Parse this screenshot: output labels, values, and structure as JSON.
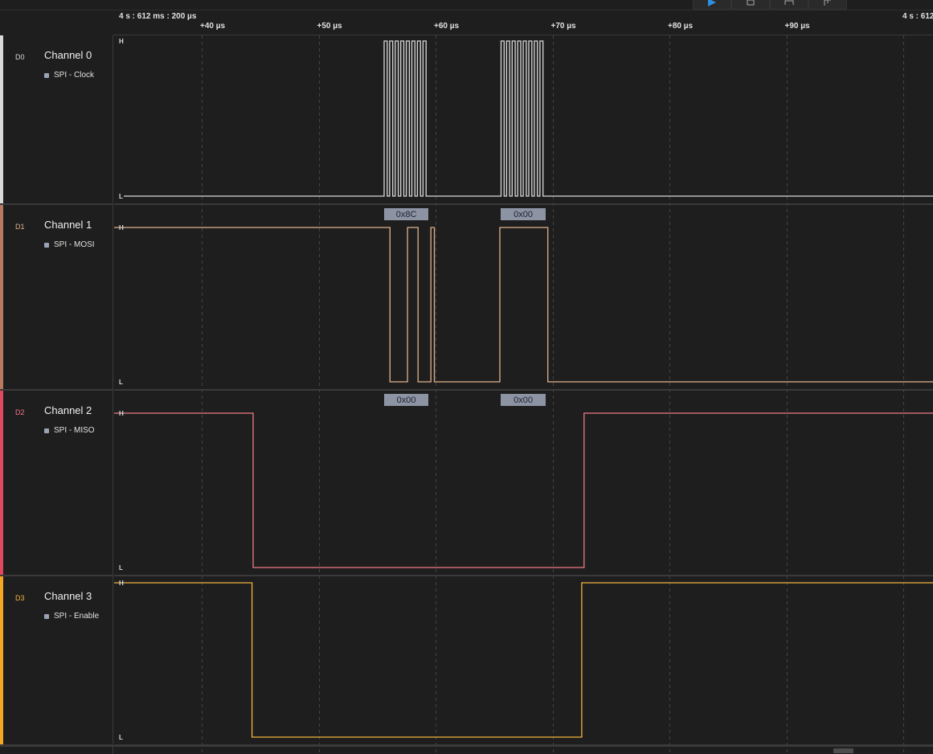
{
  "timebar": {
    "start_time": "4 s : 612 ms : 200 µs",
    "end_time_partial": "4 s : 612",
    "ticks": [
      "+40 µs",
      "+50 µs",
      "+60 µs",
      "+70 µs",
      "+80 µs",
      "+90 µs"
    ]
  },
  "toolbar": {
    "icons": [
      "play-icon",
      "trigger-icon",
      "ruler-icon",
      "marker-icon"
    ],
    "accent": "#2f8fe0"
  },
  "channels": [
    {
      "tag": "D0",
      "name": "Channel 0",
      "analyzer": "SPI - Clock",
      "color": "#d9d9d9",
      "high": "H",
      "low": "L",
      "signal": "clock",
      "bursts": [
        {
          "start_us": 55.6,
          "end_us": 59.4,
          "pulses": 8
        },
        {
          "start_us": 65.6,
          "end_us": 69.4,
          "pulses": 8
        }
      ]
    },
    {
      "tag": "D1",
      "name": "Channel 1",
      "analyzer": "SPI - MOSI",
      "color": "#e1b18a",
      "high": "H",
      "low": "L",
      "signal": "data",
      "initial": 1,
      "transitions_us": [
        56.1,
        57.6,
        58.5,
        59.6,
        59.9,
        65.5,
        69.6
      ],
      "decodes": [
        {
          "text": "0x8C",
          "start_us": 55.6,
          "end_us": 59.4
        },
        {
          "text": "0x00",
          "start_us": 65.6,
          "end_us": 69.4
        }
      ]
    },
    {
      "tag": "D2",
      "name": "Channel 2",
      "analyzer": "SPI - MISO",
      "color": "#f07a86",
      "high": "H",
      "low": "L",
      "signal": "data",
      "initial": 1,
      "transitions_us": [
        44.4,
        72.7
      ],
      "decodes": [
        {
          "text": "0x00",
          "start_us": 55.6,
          "end_us": 59.4
        },
        {
          "text": "0x00",
          "start_us": 65.6,
          "end_us": 69.4
        }
      ]
    },
    {
      "tag": "D3",
      "name": "Channel 3",
      "analyzer": "SPI - Enable",
      "color": "#f5b33e",
      "high": "H",
      "low": "L",
      "signal": "data",
      "initial": 1,
      "transitions_us": [
        44.3,
        72.5
      ],
      "decodes": []
    }
  ],
  "strip_colors": [
    "#d9d9d9",
    "#b97a5f",
    "#e0485f",
    "#f5a623"
  ],
  "axis": {
    "us_per_division": 10,
    "first_tick_us": 40
  }
}
